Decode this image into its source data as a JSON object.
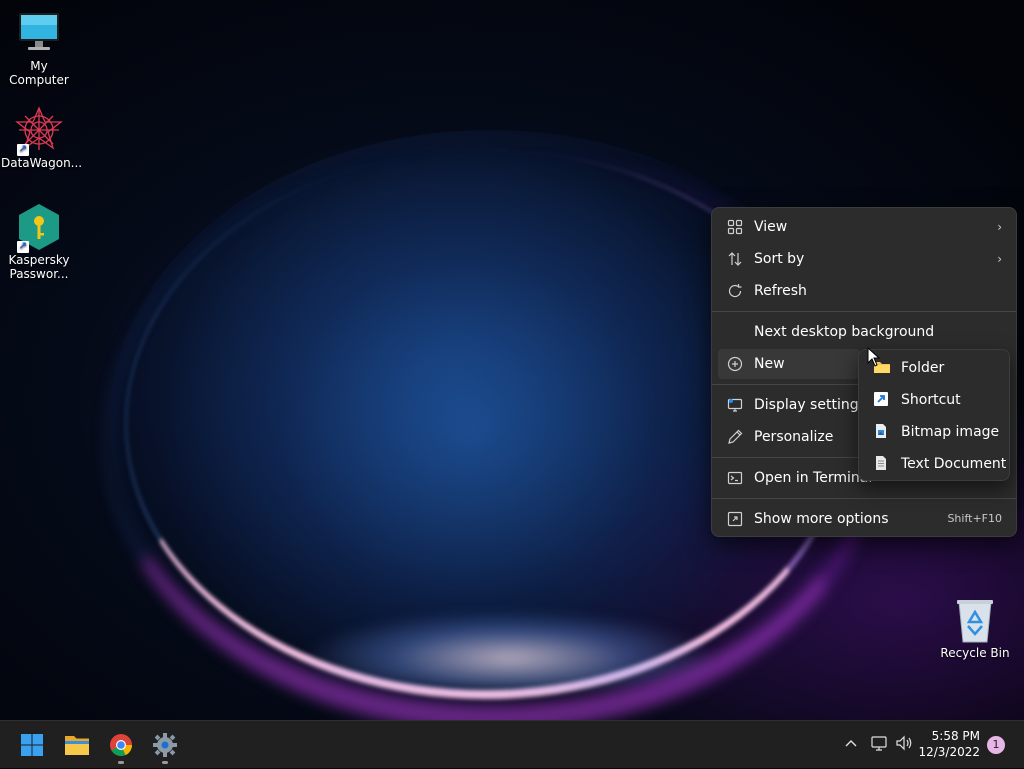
{
  "desktop": {
    "icons": [
      {
        "label": "My Computer"
      },
      {
        "label": "DataWagon..."
      },
      {
        "label": "Kaspersky Passwor..."
      },
      {
        "label": "Recycle Bin"
      }
    ]
  },
  "context_menu": {
    "items": [
      {
        "label": "View",
        "icon": "view-grid-icon",
        "has_submenu": true
      },
      {
        "label": "Sort by",
        "icon": "sort-icon",
        "has_submenu": true
      },
      {
        "label": "Refresh",
        "icon": "refresh-icon"
      },
      {
        "label": "Next desktop background"
      },
      {
        "label": "New",
        "icon": "add-circle-icon",
        "has_submenu": true
      },
      {
        "label": "Display settings",
        "icon": "display-icon"
      },
      {
        "label": "Personalize",
        "icon": "pen-icon"
      },
      {
        "label": "Open in Terminal",
        "icon": "terminal-icon"
      },
      {
        "label": "Show more options",
        "icon": "expand-icon",
        "accelerator": "Shift+F10"
      }
    ]
  },
  "new_submenu": {
    "items": [
      {
        "label": "Folder",
        "icon": "folder-icon"
      },
      {
        "label": "Shortcut",
        "icon": "shortcut-icon"
      },
      {
        "label": "Bitmap image",
        "icon": "bitmap-icon"
      },
      {
        "label": "Text Document",
        "icon": "text-document-icon"
      }
    ]
  },
  "taskbar": {
    "apps": [
      {
        "name": "start-button",
        "icon": "windows-logo-icon"
      },
      {
        "name": "file-explorer",
        "icon": "folder-icon"
      },
      {
        "name": "chrome",
        "icon": "chrome-icon",
        "running": true
      },
      {
        "name": "settings",
        "icon": "gear-icon",
        "running": true
      }
    ],
    "tray": {
      "overflow_icon": "chevron-up-icon",
      "network_icon": "network-icon",
      "volume_icon": "volume-icon"
    },
    "clock": {
      "time": "5:58 PM",
      "date": "12/3/2022"
    },
    "notification_count": "1"
  },
  "colors": {
    "menu_bg": "#2c2c2c",
    "taskbar_bg": "#202020",
    "accent_blue": "#1a8cff",
    "badge": "#e7b6e6"
  }
}
